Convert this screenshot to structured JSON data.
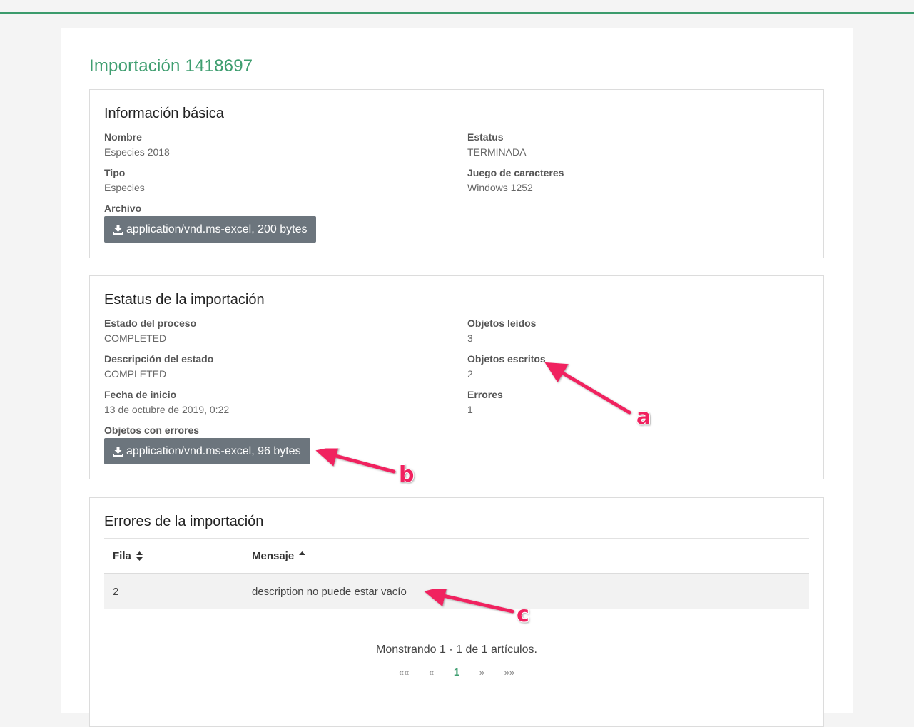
{
  "page": {
    "title": "Importación 1418697"
  },
  "basic_info": {
    "title": "Información básica",
    "name_label": "Nombre",
    "name_value": "Especies 2018",
    "type_label": "Tipo",
    "type_value": "Especies",
    "file_label": "Archivo",
    "file_button": "application/vnd.ms-excel, 200 bytes",
    "status_label": "Estatus",
    "status_value": "TERMINADA",
    "charset_label": "Juego de caracteres",
    "charset_value": "Windows 1252"
  },
  "import_status": {
    "title": "Estatus de la importación",
    "process_state_label": "Estado del proceso",
    "process_state_value": "COMPLETED",
    "state_desc_label": "Descripción del estado",
    "state_desc_value": "COMPLETED",
    "start_date_label": "Fecha de inicio",
    "start_date_value": "13 de octubre de 2019, 0:22",
    "error_objects_label": "Objetos con errores",
    "error_objects_button": "application/vnd.ms-excel, 96 bytes",
    "read_label": "Objetos leídos",
    "read_value": "3",
    "written_label": "Objetos escritos",
    "written_value": "2",
    "errors_label": "Errores",
    "errors_value": "1"
  },
  "import_errors": {
    "title": "Errores de la importación",
    "columns": [
      "Fila",
      "Mensaje"
    ],
    "rows": [
      {
        "row": "2",
        "message": "description no puede estar vacío"
      }
    ],
    "pager_info": "Monstrando 1 - 1 de 1 artículos.",
    "pager": {
      "first": "««",
      "prev": "«",
      "current": "1",
      "next": "»",
      "last": "»»"
    }
  },
  "annotations": {
    "a": "a",
    "b": "b",
    "c": "c"
  },
  "colors": {
    "accent": "#3f9e70",
    "button": "#6c757d",
    "annotation": "#f0245f"
  },
  "icons": {
    "download": "download-icon",
    "sort_both": "sort-both-icon",
    "sort_up": "sort-up-icon"
  }
}
